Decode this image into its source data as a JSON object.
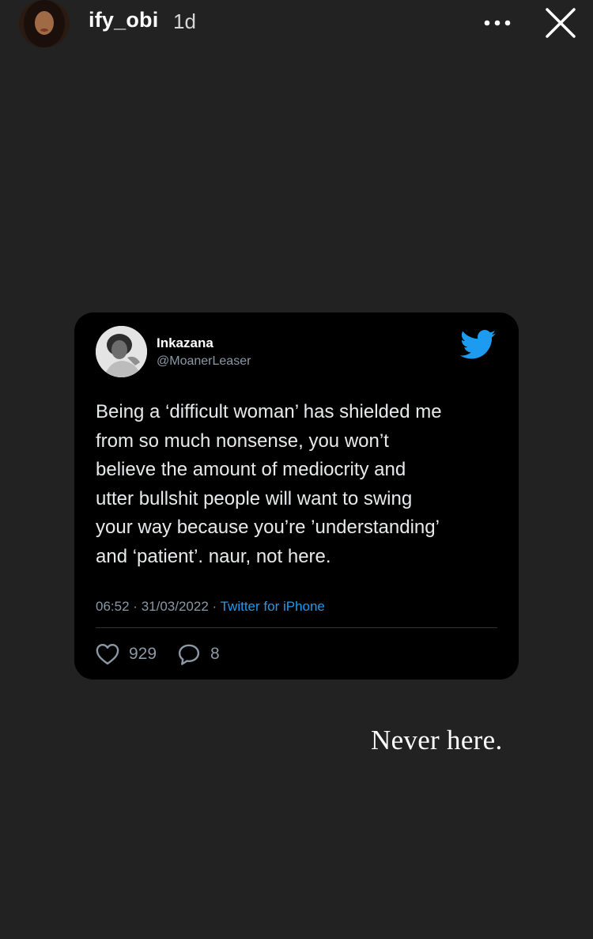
{
  "story": {
    "username": "ify_obi",
    "time_ago": "1d",
    "caption": "Never here."
  },
  "icons": {
    "more": "more-dots-icon",
    "close": "close-icon",
    "twitter": "twitter-bird-icon",
    "like": "heart-icon",
    "reply": "reply-bubble-icon"
  },
  "tweet": {
    "name": "Inkazana",
    "handle": "@MoanerLeaser",
    "text_lines": [
      "Being a ‘difficult woman’ has shielded me",
      "from so much nonsense, you won’t",
      "believe the amount of mediocrity and",
      "utter bullshit people will want to swing",
      "your way because you’re ’understanding’",
      "and ‘patient’. naur, not here."
    ],
    "time": "06:52",
    "date": "31/03/2022",
    "separator": "·",
    "source": "Twitter for iPhone",
    "likes": "929",
    "replies": "8"
  },
  "colors": {
    "background": "#222222",
    "card": "#000000",
    "twitter_blue": "#1d9bf0",
    "muted": "#8b98a5"
  }
}
